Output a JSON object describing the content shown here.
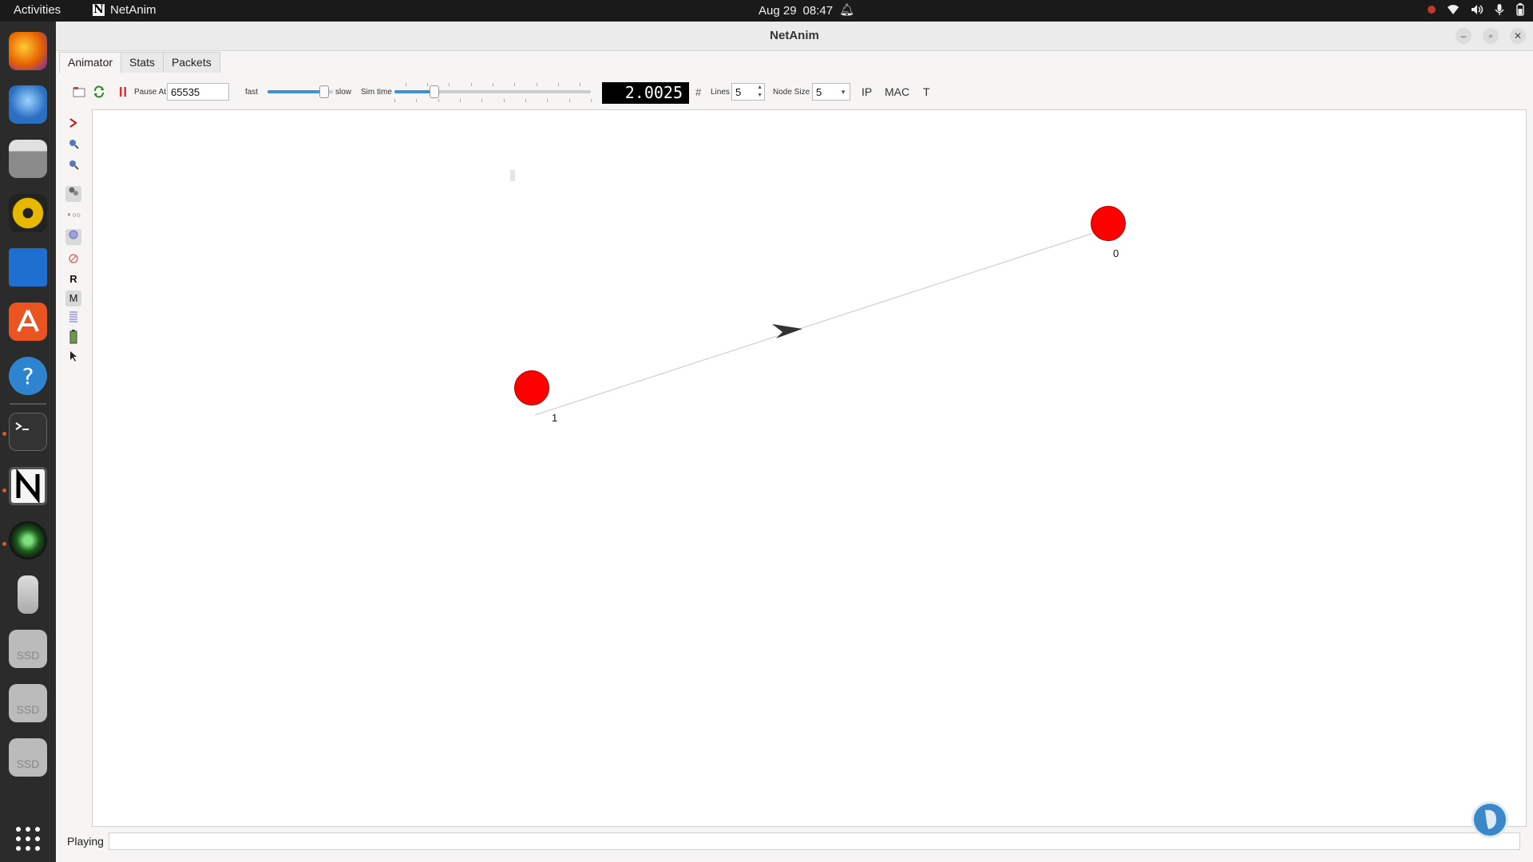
{
  "topbar": {
    "activities": "Activities",
    "app_name": "NetAnim",
    "app_logo_letter": "N",
    "clock_date": "Aug 29",
    "clock_time": "08:47"
  },
  "dock": {
    "apps": [
      {
        "name": "firefox",
        "color": "#e66000"
      },
      {
        "name": "thunderbird",
        "color": "#2b6fc2"
      },
      {
        "name": "files",
        "color": "#9a9a9a"
      },
      {
        "name": "rhythmbox",
        "color": "#e6b800"
      },
      {
        "name": "libreoffice-writer",
        "color": "#1e6fd0"
      },
      {
        "name": "software",
        "color": "#e95420"
      },
      {
        "name": "help",
        "color": "#2f84d0"
      },
      {
        "name": "terminal",
        "color": "#333333"
      },
      {
        "name": "netanim",
        "color": "#ffffff"
      },
      {
        "name": "webcam",
        "color": "#3a7a3a"
      },
      {
        "name": "usb-drive",
        "color": "#cccccc"
      },
      {
        "name": "ssd-1",
        "color": "#bbbbbb"
      },
      {
        "name": "ssd-2",
        "color": "#bbbbbb"
      },
      {
        "name": "ssd-3",
        "color": "#bbbbbb"
      }
    ],
    "ssd_label": "SSD"
  },
  "window": {
    "title": "NetAnim",
    "tabs": [
      {
        "label": "Animator",
        "active": true
      },
      {
        "label": "Stats",
        "active": false
      },
      {
        "label": "Packets",
        "active": false
      }
    ]
  },
  "toolbar": {
    "pause_at_label": "Pause At",
    "pause_at_value": "65535",
    "fast_label": "fast",
    "slow_label": "slow",
    "speed_fraction": 0.85,
    "sim_time_label": "Sim time",
    "sim_time_fraction": 0.2,
    "time_display": "2.0025",
    "hash_symbol": "#",
    "lines_label": "Lines",
    "lines_value": "5",
    "node_size_label": "Node Size",
    "node_size_value": "5",
    "ip_label": "IP",
    "mac_label": "MAC",
    "t_label": "T"
  },
  "toolstrip": {
    "r_label": "R",
    "m_label": "M"
  },
  "canvas": {
    "nodes": [
      {
        "id": "0",
        "label": "0"
      },
      {
        "id": "1",
        "label": "1"
      }
    ]
  },
  "status": {
    "state": "Playing"
  }
}
